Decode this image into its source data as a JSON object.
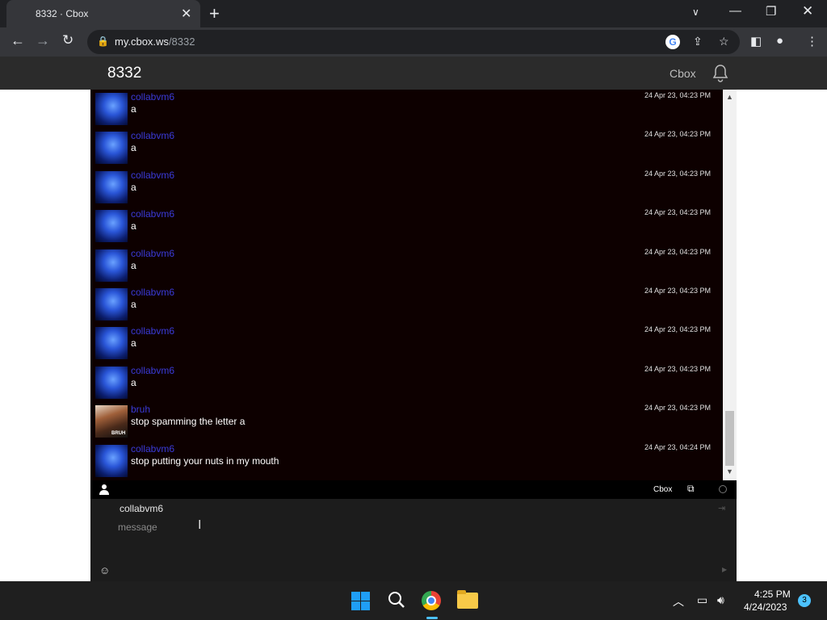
{
  "browser": {
    "tab_title": "8332 · Cbox",
    "url_domain": "my.cbox.ws",
    "url_path": "/8332"
  },
  "site": {
    "title": "8332",
    "cbox_link": "Cbox"
  },
  "messages": [
    {
      "user": "collabvm6",
      "text": "a",
      "time": "24 Apr 23, 04:23 PM",
      "avatar": "jellyfish"
    },
    {
      "user": "collabvm6",
      "text": "a",
      "time": "24 Apr 23, 04:23 PM",
      "avatar": "jellyfish"
    },
    {
      "user": "collabvm6",
      "text": "a",
      "time": "24 Apr 23, 04:23 PM",
      "avatar": "jellyfish"
    },
    {
      "user": "collabvm6",
      "text": "a",
      "time": "24 Apr 23, 04:23 PM",
      "avatar": "jellyfish"
    },
    {
      "user": "collabvm6",
      "text": "a",
      "time": "24 Apr 23, 04:23 PM",
      "avatar": "jellyfish"
    },
    {
      "user": "collabvm6",
      "text": "a",
      "time": "24 Apr 23, 04:23 PM",
      "avatar": "jellyfish"
    },
    {
      "user": "collabvm6",
      "text": "a",
      "time": "24 Apr 23, 04:23 PM",
      "avatar": "jellyfish"
    },
    {
      "user": "collabvm6",
      "text": "a",
      "time": "24 Apr 23, 04:23 PM",
      "avatar": "jellyfish"
    },
    {
      "user": "bruh",
      "text": "stop spamming the letter a",
      "time": "24 Apr 23, 04:23 PM",
      "avatar": "bruh"
    },
    {
      "user": "collabvm6",
      "text": "stop putting your nuts in my mouth",
      "time": "24 Apr 23, 04:24 PM",
      "avatar": "jellyfish"
    }
  ],
  "bruh_avatar_tag": "BRUH",
  "chat_toolbar": {
    "cbox_label": "Cbox"
  },
  "composer": {
    "name": "collabvm6",
    "placeholder": "message"
  },
  "taskbar": {
    "time": "4:25 PM",
    "date": "4/24/2023",
    "notification_count": "3"
  },
  "colors": {
    "username": "#3a3ad8",
    "chat_bg": "#0d0000",
    "accent": "#4cc2ff"
  }
}
